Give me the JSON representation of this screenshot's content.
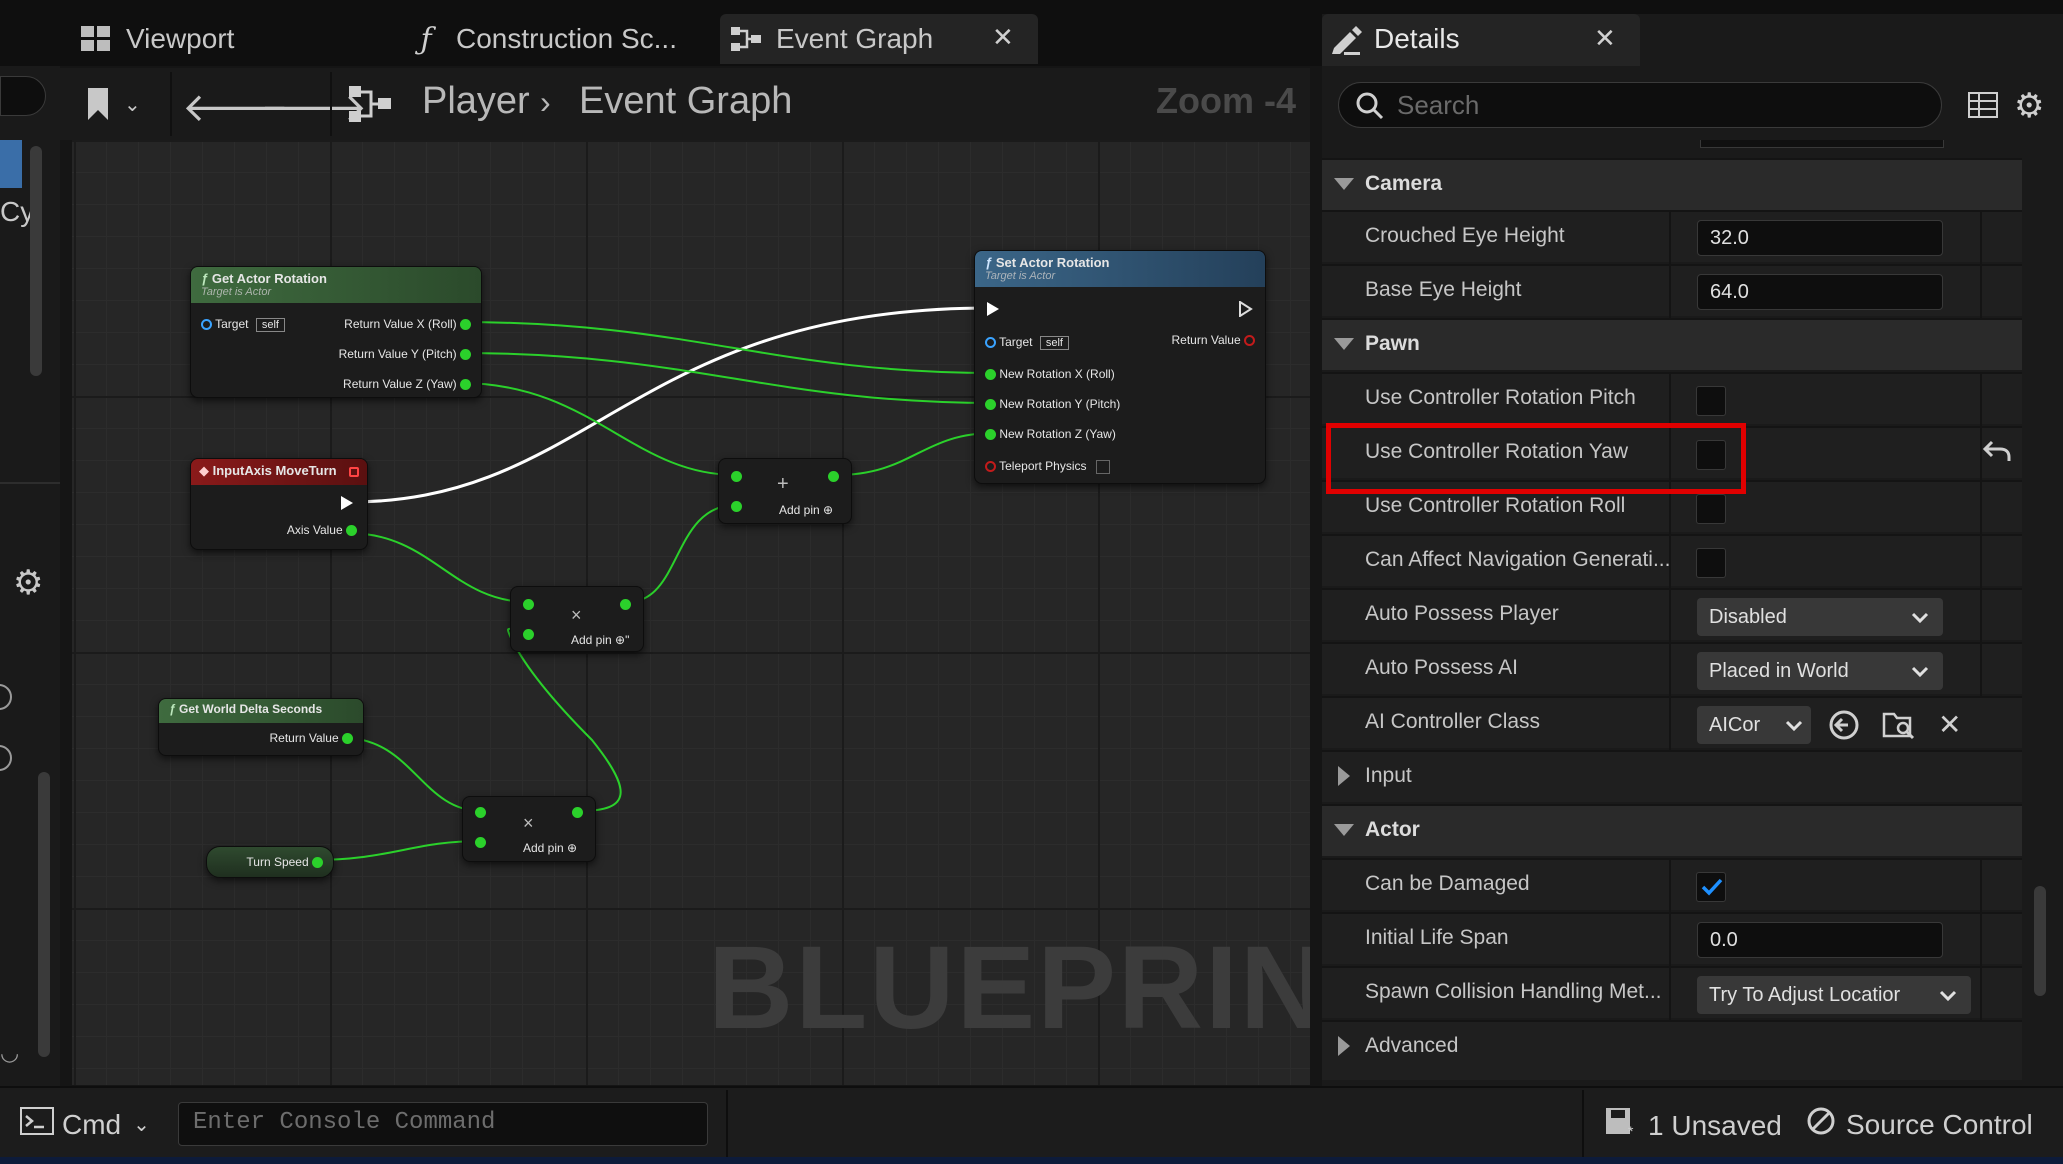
{
  "tabs": [
    {
      "label": "Viewport",
      "icon": "viewport-grid-icon"
    },
    {
      "label": "Construction Sc...",
      "icon": "function-icon"
    },
    {
      "label": "Event Graph",
      "icon": "event-graph-icon",
      "active": true
    }
  ],
  "breadcrumb": {
    "root": "Player",
    "current": "Event Graph"
  },
  "zoom": "Zoom -4",
  "left_strip_text": "Cyl",
  "graph": {
    "watermark": "BLUEPRINT",
    "nodes": {
      "get_actor_rotation": {
        "title": "Get Actor Rotation",
        "subtitle": "Target is Actor",
        "target_label": "Target",
        "target_value": "self",
        "outputs": [
          "Return Value X (Roll)",
          "Return Value Y (Pitch)",
          "Return Value Z (Yaw)"
        ]
      },
      "input_axis": {
        "title": "InputAxis MoveTurn",
        "output": "Axis Value"
      },
      "get_world_delta": {
        "title": "Get World Delta Seconds",
        "output": "Return Value"
      },
      "turn_speed": {
        "label": "Turn Speed"
      },
      "add_node": {
        "symbol": "+",
        "add_pin": "Add pin"
      },
      "multiply_node_1": {
        "symbol": "×",
        "add_pin": "Add pin"
      },
      "multiply_node_2": {
        "symbol": "×",
        "add_pin": "Add pin"
      },
      "set_actor_rotation": {
        "title": "Set Actor Rotation",
        "subtitle": "Target is Actor",
        "target_label": "Target",
        "target_value": "self",
        "return_value": "Return Value",
        "inputs": [
          "New Rotation X (Roll)",
          "New Rotation Y (Pitch)",
          "New Rotation Z (Yaw)"
        ],
        "teleport": "Teleport Physics"
      }
    }
  },
  "details": {
    "title": "Details",
    "search_placeholder": "Search",
    "categories": {
      "camera": "Camera",
      "pawn": "Pawn",
      "input": "Input",
      "actor": "Actor",
      "advanced": "Advanced"
    },
    "props": {
      "crouched_eye_height": {
        "label": "Crouched Eye Height",
        "value": "32.0"
      },
      "base_eye_height": {
        "label": "Base Eye Height",
        "value": "64.0"
      },
      "use_pitch": {
        "label": "Use Controller Rotation Pitch",
        "checked": false
      },
      "use_yaw": {
        "label": "Use Controller Rotation Yaw",
        "checked": false
      },
      "use_roll": {
        "label": "Use Controller Rotation Roll",
        "checked": false
      },
      "can_affect_nav": {
        "label": "Can Affect Navigation Generati...",
        "checked": false
      },
      "auto_possess_player": {
        "label": "Auto Possess Player",
        "value": "Disabled"
      },
      "auto_possess_ai": {
        "label": "Auto Possess AI",
        "value": "Placed in World"
      },
      "ai_controller_class": {
        "label": "AI Controller Class",
        "value": "AICor"
      },
      "can_be_damaged": {
        "label": "Can be Damaged",
        "checked": true
      },
      "initial_life_span": {
        "label": "Initial Life Span",
        "value": "0.0"
      },
      "spawn_collision": {
        "label": "Spawn Collision Handling Met...",
        "value": "Try To Adjust Locatior"
      }
    }
  },
  "statusbar": {
    "cmd_label": "Cmd",
    "console_placeholder": "Enter Console Command",
    "unsaved": "1 Unsaved",
    "source_control": "Source Control"
  },
  "colors": {
    "highlight": "#e00000",
    "exec_pin": "#ffffff",
    "float_pin": "#2bd12b",
    "checkbox_check": "#1e90ff"
  }
}
